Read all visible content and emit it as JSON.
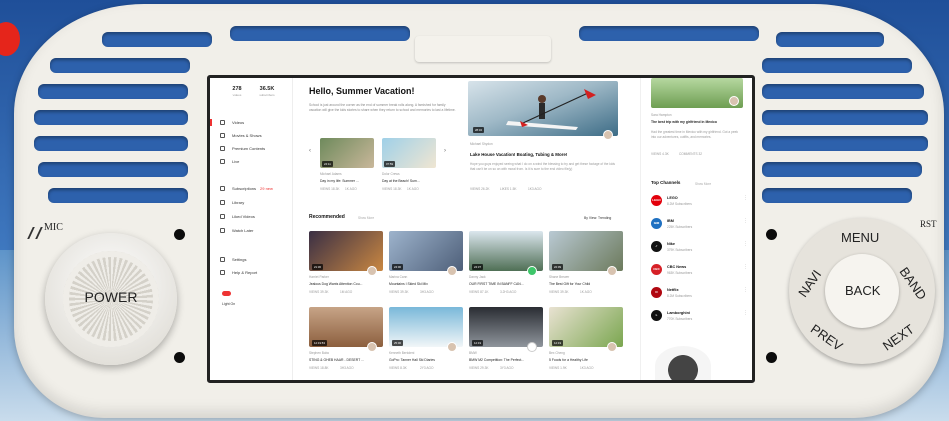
{
  "device": {
    "power_label": "POWER",
    "mic_label": "MIC",
    "rst_label": "RST",
    "keys": {
      "menu": "MENU",
      "navi": "NAVI",
      "back": "BACK",
      "band": "BAND",
      "prev": "PREV",
      "next": "NEXT"
    }
  },
  "sidebar": {
    "stats": [
      {
        "value": "278",
        "label": "videos"
      },
      {
        "value": "36.5K",
        "label": "subscribers"
      }
    ],
    "items": [
      {
        "label": "Videos"
      },
      {
        "label": "Movies & Shows"
      },
      {
        "label": "Premium Contents"
      },
      {
        "label": "Live"
      }
    ],
    "items2": [
      {
        "label": "Subscriptions",
        "badge": "29 new"
      },
      {
        "label": "Library"
      },
      {
        "label": "Liked Videos"
      },
      {
        "label": "Watch Later"
      }
    ],
    "items3": [
      {
        "label": "Settings"
      },
      {
        "label": "Help & Report"
      }
    ],
    "light_label": "Light On"
  },
  "main": {
    "title": "Hello, Summer Vacation!",
    "intro": "School is just around the corner as the end of summer break rolls along. A famished for family vacation will give the kids stories to share when they return to school and memories to last a lifetime.",
    "mini": [
      {
        "channel": "Michael Adams",
        "title": "Day in my life: Summer ...",
        "views": "VIEWS 18.3K",
        "age": "1K AGO",
        "time": "24:11"
      },
      {
        "channel": "Dolor Crews",
        "title": "Day at the Beach! Sum...",
        "views": "VIEWS 18.3K",
        "age": "1K AGO",
        "time": "07:59"
      }
    ],
    "featured": {
      "time": "28:32",
      "channel": "Michael Shydon",
      "title": "Lake House Vacation! Boating, Tubing & More!",
      "desc": "Hope you guys enjoyed seeing what I do on a wind the blessing to try and get these footage of the kids that can't be on so on with moral from. Is it is sure to the end video file(y)",
      "views": "VIEWS 26.2K",
      "likes": "LIKES 1.5K",
      "age": "1K3 AGO"
    },
    "recommended": "Recommended",
    "show_more": "Show More",
    "trending": "By View: Trending",
    "cards": [
      {
        "channel": "Harriet Parker",
        "title": "Jealous Dog Wants Attention Cou...",
        "views": "VIEWS 39.3K",
        "age": "1M AGO",
        "time": "21:30"
      },
      {
        "channel": "Marina Cann",
        "title": "Mountains I Skied Ski Mix",
        "views": "VIEWS 39.3K",
        "age": "3H3 AGO",
        "time": "24:00"
      },
      {
        "channel": "Danny Jack",
        "title": "OUR FIRST TIME IN BANFF CAN...",
        "views": "VIEWS 87.1K",
        "age": "3.2H3 AGO",
        "time": "24:37"
      },
      {
        "channel": "Shane Brewer",
        "title": "The Best Gift for Your Child",
        "views": "VIEWS 39.3K",
        "age": "1K AGO",
        "time": "22:09"
      },
      {
        "channel": "Stephen Bobo",
        "title": "STING & GHEB HAAR - DESERT ...",
        "views": "VIEWS 18.8K",
        "age": "3H3 AGO",
        "time": "12:19:53"
      },
      {
        "channel": "Kenneth Bertoleni",
        "title": "GoPro: Tanner Hall Ski Diaries",
        "views": "VIEWS 8.3K",
        "age": "2Y3 AGO",
        "time": "25:00"
      },
      {
        "channel": "BMW",
        "title": "BMW M2 Competition: The Perfect...",
        "views": "VIEWS 29.3K",
        "age": "3Y3 AGO",
        "time": "12:19"
      },
      {
        "channel": "Bex Cheng",
        "title": "5 Foods for a Healthy Life",
        "views": "VIEWS 1.9K",
        "age": "1K3 AGO",
        "time": "12:19"
      }
    ]
  },
  "right": {
    "top_post": {
      "title": "The best trip with my girlfriend in Mexico",
      "desc": "Had the greatest time in Mexico with my girlfriend. Got a peek into our adventures, outfits, and memories.",
      "channel": "Sara Hampton",
      "views": "VIEWS 4.3K",
      "comments": "COMMENTS 32"
    },
    "top_channels": "Top Channels",
    "show_more": "Show More",
    "channels": [
      {
        "name": "LEGO",
        "subs": "8.2M Subscribers",
        "color": "#e3000b",
        "logo": "LEGO"
      },
      {
        "name": "IBM",
        "subs": "225K Subscribers",
        "color": "#1f70c1",
        "logo": "IBM"
      },
      {
        "name": "Nike",
        "subs": "379K Subscribers",
        "color": "#111111",
        "logo": "✓"
      },
      {
        "name": "CBC News",
        "subs": "963K Subscribers",
        "color": "#d62027",
        "logo": "CBC"
      },
      {
        "name": "Netflix",
        "subs": "8.2M Subscribers",
        "color": "#b00710",
        "logo": "N"
      },
      {
        "name": "Lamborghini",
        "subs": "770K Subscribers",
        "color": "#111111",
        "logo": "L"
      }
    ]
  }
}
